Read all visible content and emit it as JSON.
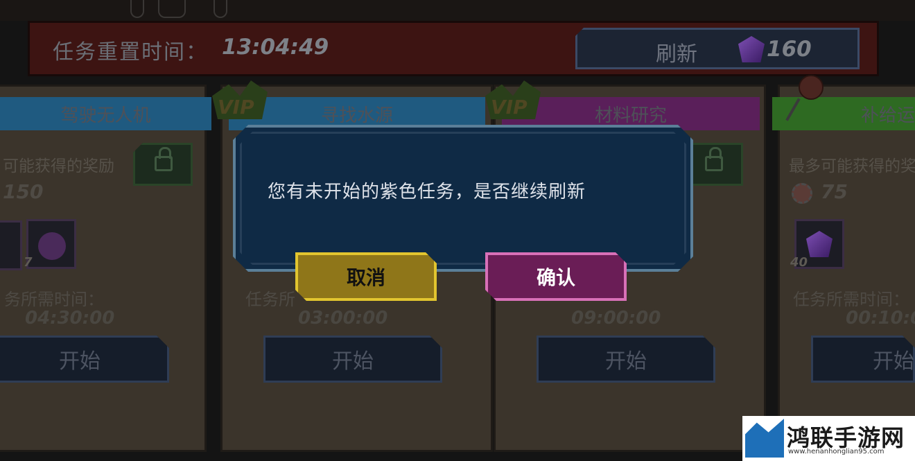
{
  "header": {
    "reset_label": "任务重置时间：",
    "reset_time": "13:04:49",
    "refresh_label": "刷新",
    "refresh_cost": "160"
  },
  "missions": [
    {
      "title": "驾驶无人机",
      "reward_label": "可能获得的奖励",
      "reward_amount": "150",
      "item_count": "7",
      "time_label": "务所需时间：",
      "duration": "04:30:00",
      "start_label": "开始",
      "banner_color": "#1f5a80"
    },
    {
      "title": "寻找水源",
      "duration": "03:00:00",
      "time_label": "任务所",
      "start_label": "开始",
      "vip": "VIP",
      "banner_color": "#1f5a80"
    },
    {
      "title": "材料研究",
      "duration": "09:00:00",
      "start_label": "开始",
      "vip": "VIP",
      "banner_color": "#5a1f5a"
    },
    {
      "title": "补给运",
      "reward_label": "最多可能获得的奖",
      "reward_amount": "75",
      "item_count": "40",
      "time_label": "任务所需时间：",
      "duration": "00:10:0",
      "start_label": "开始",
      "banner_color": "#2e6a22"
    }
  ],
  "dialog": {
    "message": "您有未开始的紫色任务，是否继续刷新",
    "cancel_label": "取消",
    "confirm_label": "确认"
  },
  "watermark": {
    "name": "鸿联手游网",
    "url": "www.henanhonglian95.com"
  }
}
